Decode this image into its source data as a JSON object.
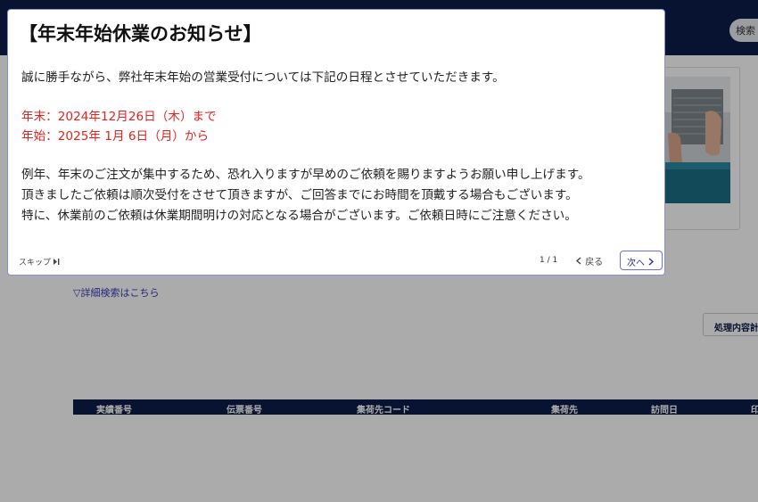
{
  "header": {
    "search_label": "検索"
  },
  "search": {
    "advanced_link": "▽詳細検索はこちら"
  },
  "actions": {
    "process_button": "処理内容計"
  },
  "table": {
    "columns": [
      "実績番号",
      "伝票番号",
      "集荷先コード",
      "集荷先",
      "訪問日",
      "印"
    ]
  },
  "modal": {
    "title": "【年末年始休業のお知らせ】",
    "intro": "誠に勝手ながら、弊社年末年始の営業受付については下記の日程とさせていただきます。",
    "schedule": [
      "年末：2024年12月26日（木）まで",
      "年始：2025年 1月 6日（月）から"
    ],
    "body": [
      "例年、年末のご注文が集中するため、恐れ入りますが早めのご依頼を賜りますようお願い申し上げます。",
      "頂きましたご依頼は順次受付をさせて頂きますが、ご回答までにお時間を頂戴する場合もございます。",
      "特に、休業前のご依頼は休業期間明けの対応となる場合がございます。ご依頼日時にご注意ください。"
    ],
    "skip_label": "スキップ",
    "pager": "1 / 1",
    "back_label": "戻る",
    "next_label": "次へ"
  },
  "colors": {
    "navy": "#0d1b4a",
    "notice_red": "#e8211d",
    "link": "#3a3ab8"
  },
  "icons": {
    "skip": "skip-forward-icon",
    "back": "chevron-left-icon",
    "next": "chevron-right-icon"
  }
}
